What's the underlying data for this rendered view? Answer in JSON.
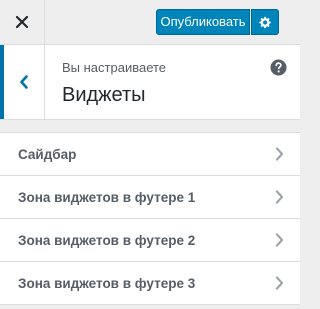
{
  "header": {
    "close_icon": "close-icon",
    "publish_label": "Опубликовать",
    "settings_icon": "gear-icon"
  },
  "section": {
    "back_icon": "chevron-left-icon",
    "customizing_label": "Вы настраиваете",
    "title": "Виджеты",
    "help_icon": "help-circle-icon"
  },
  "widget_areas": [
    {
      "label": "Сайдбар"
    },
    {
      "label": "Зона виджетов в футере 1"
    },
    {
      "label": "Зона виджетов в футере 2"
    },
    {
      "label": "Зона виджетов в футере 3"
    }
  ],
  "colors": {
    "accent": "#0085ba",
    "back_accent": "#0073aa",
    "background": "#eeeeee",
    "panel": "#ffffff"
  }
}
